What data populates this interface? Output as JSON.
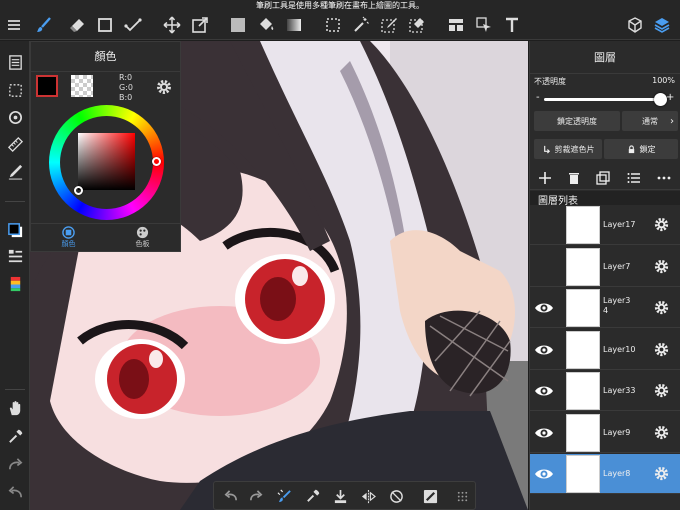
{
  "tooltip": "筆刷工具是使用多種筆刷在畫布上繪圖的工具。",
  "toolbar": {
    "icons": [
      "menu-icon",
      "brush-icon",
      "eraser-icon",
      "rectangle-icon",
      "check-shape-icon",
      "move-icon",
      "transform-icon",
      "fill-square-icon",
      "bucket-icon",
      "gradient-icon",
      "selection-icon",
      "magic-wand-icon",
      "select-pen-icon",
      "select-eraser-icon",
      "layout-icon",
      "select-arrow-icon",
      "text-icon",
      "3d-icon",
      "layers-icon"
    ]
  },
  "color_panel": {
    "title": "顏色",
    "r": "R:0",
    "g": "G:0",
    "b": "B:0",
    "tab_color": "顏色",
    "tab_palette": "色板",
    "main_color": "#000000",
    "accent": "#4a8fd6"
  },
  "layers_panel": {
    "title": "圖層",
    "opacity_label": "不透明度",
    "opacity_value": "100%",
    "opacity_level": 1.0,
    "minus": "-",
    "plus": "+",
    "lock_alpha": "鎖定透明度",
    "blend_mode": "通常",
    "clipping": "剪裁遮色片",
    "lock": "鎖定",
    "list_title": "圖層列表",
    "layers": [
      {
        "name": "Layer17",
        "visible": false,
        "selected": false
      },
      {
        "name": "Layer7",
        "visible": false,
        "selected": false
      },
      {
        "name": "Layer3\n4",
        "visible": true,
        "selected": false
      },
      {
        "name": "Layer10",
        "visible": true,
        "selected": false
      },
      {
        "name": "Layer33",
        "visible": true,
        "selected": false
      },
      {
        "name": "Layer9",
        "visible": true,
        "selected": false
      },
      {
        "name": "Layer8",
        "visible": true,
        "selected": true
      }
    ]
  },
  "canvas": {
    "description_colors": {
      "hair": "#3a3136",
      "eyes": "#c8232b",
      "skin": "#f7dfe0",
      "sweater": "#2b2b33"
    }
  }
}
